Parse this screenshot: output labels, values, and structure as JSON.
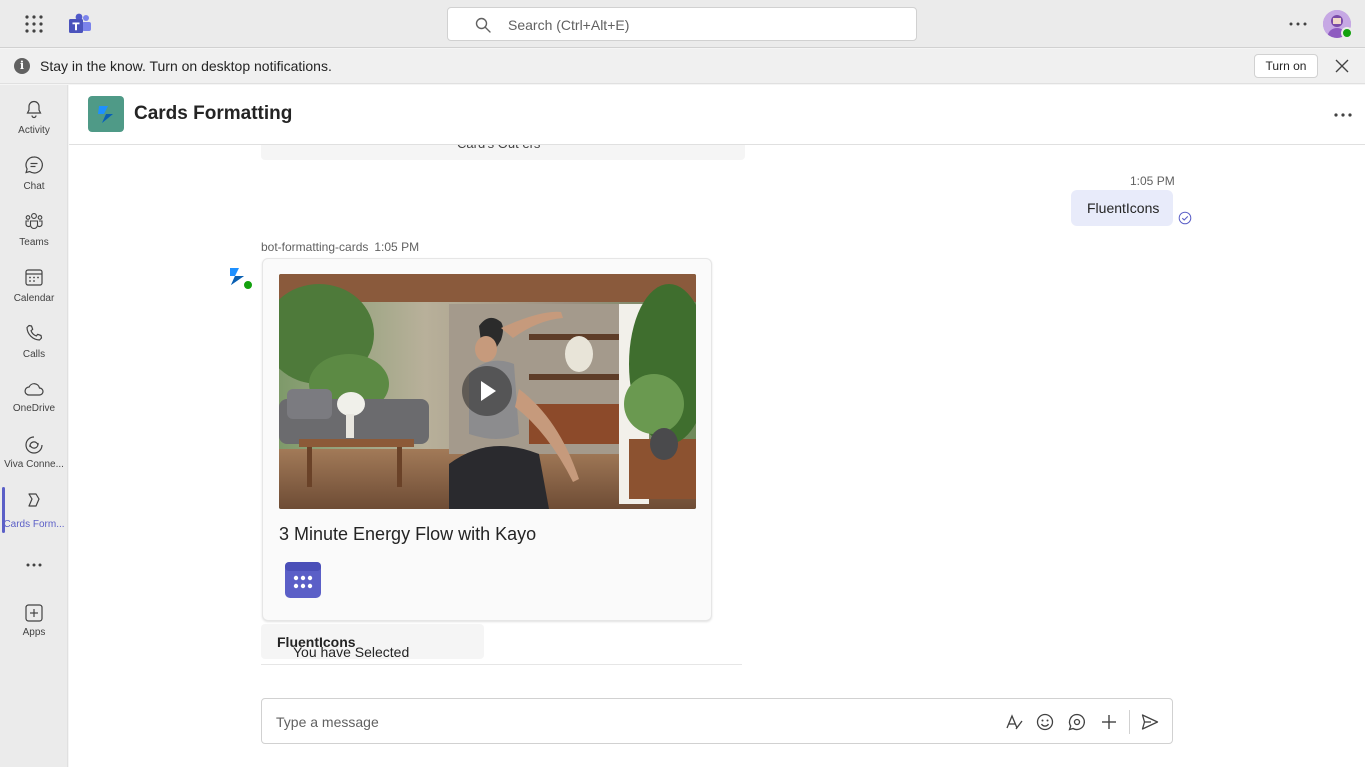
{
  "topbar": {
    "search_placeholder": "Search (Ctrl+Alt+E)"
  },
  "notification": {
    "message": "Stay in the know. Turn on desktop notifications.",
    "turn_on_label": "Turn on",
    "info_glyph": "i"
  },
  "rail": {
    "items": [
      {
        "label": "Activity",
        "icon": "bell-icon"
      },
      {
        "label": "Chat",
        "icon": "chat-icon"
      },
      {
        "label": "Teams",
        "icon": "teams-icon"
      },
      {
        "label": "Calendar",
        "icon": "calendar-icon"
      },
      {
        "label": "Calls",
        "icon": "phone-icon"
      },
      {
        "label": "OneDrive",
        "icon": "cloud-icon"
      },
      {
        "label": "Viva Conne...",
        "icon": "viva-icon"
      },
      {
        "label": "Cards Form...",
        "icon": "app-icon",
        "active": true
      },
      {
        "label": "Apps",
        "icon": "add-app-icon"
      }
    ]
  },
  "header": {
    "title": "Cards Formatting"
  },
  "conversation": {
    "previous_card_text": "Card's Out ers",
    "my_message": {
      "time": "1:05 PM",
      "text": "FluentIcons"
    },
    "bot_message": {
      "sender": "bot-formatting-cards",
      "time": "1:05 PM",
      "card_title": "3 Minute Energy Flow with Kayo"
    },
    "selection_reply": {
      "prefix": "You have Selected",
      "value": "FluentIcons"
    }
  },
  "compose": {
    "placeholder": "Type a message"
  },
  "colors": {
    "accent": "#5b5fc7",
    "online": "#13a10e",
    "app_tile": "#4f9a87"
  }
}
